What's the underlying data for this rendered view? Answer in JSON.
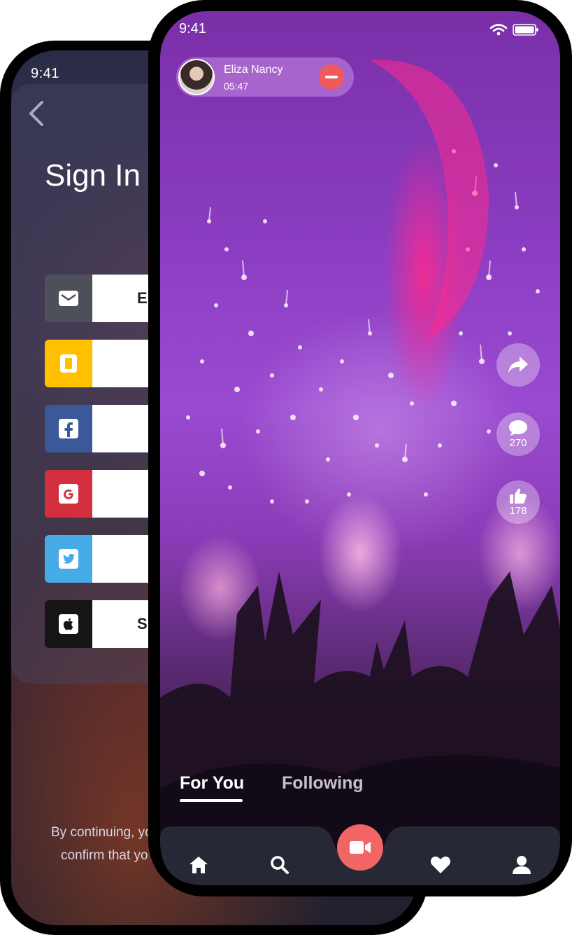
{
  "back_phone": {
    "status_time": "9:41",
    "title": "Sign In",
    "auth_options": [
      {
        "label": "E",
        "icon": "email-icon",
        "color": "#4d5058"
      },
      {
        "label": "",
        "icon": "phone-icon",
        "color": "#ffc000"
      },
      {
        "label": "",
        "icon": "facebook-icon",
        "color": "#3b5998"
      },
      {
        "label": "",
        "icon": "google-icon",
        "color": "#d32f3f"
      },
      {
        "label": "",
        "icon": "twitter-icon",
        "color": "#47abe8"
      },
      {
        "label": "S",
        "icon": "apple-icon",
        "color": "#151515"
      }
    ],
    "terms_line1": "By continuing, yo",
    "terms_line2": "confirm that yo"
  },
  "front_phone": {
    "status_time": "9:41",
    "live": {
      "name": "Eliza Nancy",
      "duration": "05:47"
    },
    "actions": {
      "comments_count": "270",
      "likes_count": "178"
    },
    "tabs": [
      {
        "label": "For You",
        "active": true
      },
      {
        "label": "Following",
        "active": false
      }
    ],
    "bottom_nav": [
      "home-icon",
      "search-icon",
      "video-camera-icon",
      "heart-icon",
      "profile-icon"
    ],
    "accent_color": "#f26565"
  }
}
